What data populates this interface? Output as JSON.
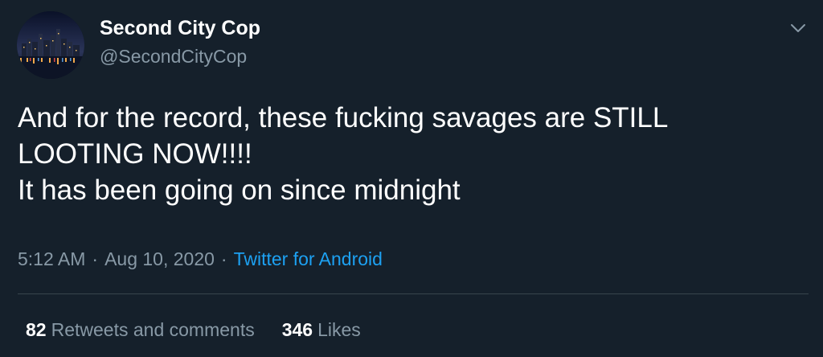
{
  "author": {
    "display_name": "Second City Cop",
    "handle": "@SecondCityCop",
    "avatar_icon": "city-skyline-night-avatar"
  },
  "menu": {
    "icon": "chevron-down-icon"
  },
  "tweet": {
    "lines": [
      "And for the record, these fucking savages are STILL",
      "LOOTING NOW!!!!",
      "It has been going on since midnight"
    ]
  },
  "meta": {
    "time": "5:12 AM",
    "separator": "·",
    "date": "Aug 10, 2020",
    "source": "Twitter for Android"
  },
  "stats": {
    "retweets_count": "82",
    "retweets_label": "Retweets and comments",
    "likes_count": "346",
    "likes_label": "Likes"
  },
  "colors": {
    "background": "#15202b",
    "primary_text": "#ffffff",
    "secondary_text": "#8899a6",
    "link": "#1da1f2",
    "divider": "#38444d"
  }
}
